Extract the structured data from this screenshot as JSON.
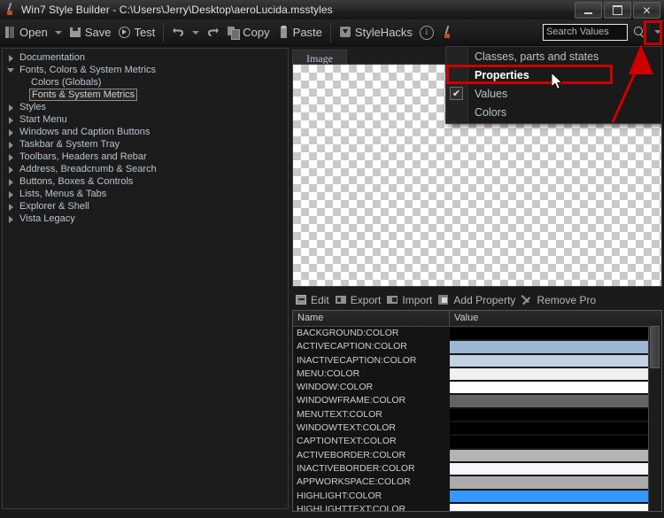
{
  "window": {
    "title": "Win7 Style Builder - C:\\Users\\Jerry\\Desktop\\aeroLucida.msstyles",
    "app_icon": "brush-icon",
    "controls": {
      "minimize": "Minimize",
      "maximize": "Maximize",
      "close": "Close"
    }
  },
  "toolbar": {
    "items": [
      {
        "label": "Open",
        "icon": "open-icon",
        "has_caret": true
      },
      {
        "label": "Save",
        "icon": "save-icon",
        "has_caret": false
      },
      {
        "label": "Test",
        "icon": "test-icon",
        "has_caret": false
      },
      {
        "label": "",
        "icon": "undo-icon",
        "has_caret": true
      },
      {
        "label": "",
        "icon": "redo-icon",
        "has_caret": false
      },
      {
        "label": "Copy",
        "icon": "copy-icon",
        "has_caret": false
      },
      {
        "label": "Paste",
        "icon": "paste-icon",
        "has_caret": false
      },
      {
        "label": "StyleHacks",
        "icon": "stylehacks-icon",
        "has_caret": false
      },
      {
        "label": "",
        "icon": "info-icon",
        "has_caret": false
      },
      {
        "label": "",
        "icon": "brush-icon",
        "has_caret": false
      }
    ]
  },
  "search": {
    "placeholder": "Search Values",
    "value": "",
    "search_icon": "magnifier-icon",
    "dropdown_icon": "chevron-down-icon"
  },
  "tree": {
    "items": [
      {
        "label": "Documentation",
        "level": 0,
        "state": "collapsed",
        "selected": false
      },
      {
        "label": "Fonts, Colors & System Metrics",
        "level": 0,
        "state": "expanded",
        "selected": false
      },
      {
        "label": "Colors (Globals)",
        "level": 1,
        "state": "leaf",
        "selected": false
      },
      {
        "label": "Fonts & System Metrics",
        "level": 1,
        "state": "leaf",
        "selected": true
      },
      {
        "label": "Styles",
        "level": 0,
        "state": "collapsed",
        "selected": false
      },
      {
        "label": "Start Menu",
        "level": 0,
        "state": "collapsed",
        "selected": false
      },
      {
        "label": "Windows and Caption Buttons",
        "level": 0,
        "state": "collapsed",
        "selected": false
      },
      {
        "label": "Taskbar & System Tray",
        "level": 0,
        "state": "collapsed",
        "selected": false
      },
      {
        "label": "Toolbars, Headers and Rebar",
        "level": 0,
        "state": "collapsed",
        "selected": false
      },
      {
        "label": "Address, Breadcrumb & Search",
        "level": 0,
        "state": "collapsed",
        "selected": false
      },
      {
        "label": "Buttons, Boxes & Controls",
        "level": 0,
        "state": "collapsed",
        "selected": false
      },
      {
        "label": "Lists, Menus & Tabs",
        "level": 0,
        "state": "collapsed",
        "selected": false
      },
      {
        "label": "Explorer & Shell",
        "level": 0,
        "state": "collapsed",
        "selected": false
      },
      {
        "label": "Vista Legacy",
        "level": 0,
        "state": "collapsed",
        "selected": false
      }
    ]
  },
  "preview": {
    "tab_label": "Image",
    "content": "transparent-checkerboard"
  },
  "property_toolbar": {
    "items": [
      {
        "label": "Edit",
        "icon": "edit-icon"
      },
      {
        "label": "Export",
        "icon": "export-icon"
      },
      {
        "label": "Import",
        "icon": "import-icon"
      },
      {
        "label": "Add Property",
        "icon": "add-property-icon"
      },
      {
        "label": "Remove Pro",
        "icon": "remove-property-icon"
      }
    ]
  },
  "property_table": {
    "columns": [
      "Name",
      "Value"
    ],
    "rows": [
      {
        "name": "BACKGROUND:COLOR",
        "value_color": "#000000"
      },
      {
        "name": "ACTIVECAPTION:COLOR",
        "value_color": "#9cb6d4"
      },
      {
        "name": "INACTIVECAPTION:COLOR",
        "value_color": "#c0d2e4"
      },
      {
        "name": "MENU:COLOR",
        "value_color": "#f0f0f0"
      },
      {
        "name": "WINDOW:COLOR",
        "value_color": "#ffffff"
      },
      {
        "name": "WINDOWFRAME:COLOR",
        "value_color": "#646464"
      },
      {
        "name": "MENUTEXT:COLOR",
        "value_color": "#000000"
      },
      {
        "name": "WINDOWTEXT:COLOR",
        "value_color": "#000000"
      },
      {
        "name": "CAPTIONTEXT:COLOR",
        "value_color": "#000000"
      },
      {
        "name": "ACTIVEBORDER:COLOR",
        "value_color": "#b4b4b4"
      },
      {
        "name": "INACTIVEBORDER:COLOR",
        "value_color": "#f4f7fc"
      },
      {
        "name": "APPWORKSPACE:COLOR",
        "value_color": "#ababab"
      },
      {
        "name": "HIGHLIGHT:COLOR",
        "value_color": "#3399ff"
      },
      {
        "name": "HIGHLIGHTTEXT:COLOR",
        "value_color": "#ffffff"
      }
    ]
  },
  "view_menu": {
    "items": [
      {
        "label": "Classes, parts and states",
        "checked": false,
        "active": false
      },
      {
        "label": "Properties",
        "checked": false,
        "active": true
      },
      {
        "label": "Values",
        "checked": true,
        "active": false
      },
      {
        "label": "Colors",
        "checked": false,
        "active": false
      }
    ],
    "check_glyph": "✔"
  },
  "annotations": {
    "highlight_color": "#cc0000",
    "arrow": "red-arrow-up",
    "cursor": "mouse-pointer"
  }
}
